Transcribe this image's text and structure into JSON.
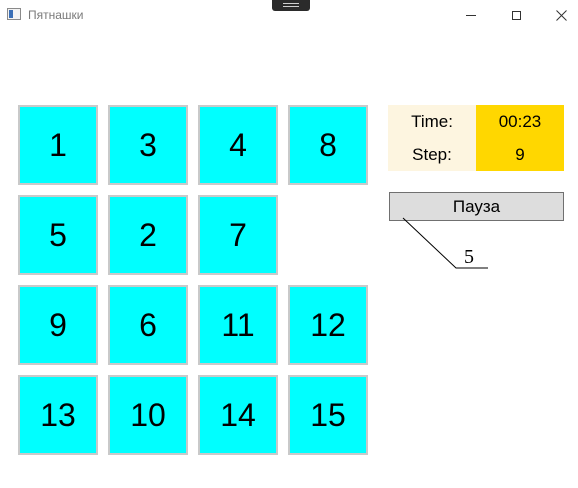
{
  "window": {
    "title": "Пятнашки",
    "controls": [
      "minimize-icon",
      "maximize-icon",
      "close-icon"
    ]
  },
  "board": {
    "tiles": [
      "1",
      "3",
      "4",
      "8",
      "5",
      "2",
      "7",
      "",
      "9",
      "6",
      "11",
      "12",
      "13",
      "10",
      "14",
      "15"
    ]
  },
  "stats": {
    "time_label": "Time:",
    "time_value": "00:23",
    "step_label": "Step:",
    "step_value": "9"
  },
  "pause_button": {
    "label": "Пауза"
  },
  "callout": {
    "label": "5"
  },
  "colors": {
    "tile": "#00ffff",
    "tile_border": "#c9c9c9",
    "label_bg": "#fdf5e0",
    "value_bg": "#ffd700",
    "button_bg": "#dddddd"
  }
}
